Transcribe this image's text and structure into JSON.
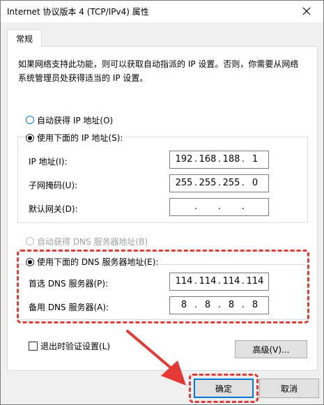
{
  "window": {
    "title": "Internet 协议版本 4 (TCP/IPv4) 属性"
  },
  "tabs": [
    {
      "label": "常规"
    }
  ],
  "description": "如果网络支持此功能，则可以获取自动指派的 IP 设置。否则，你需要从网络系统管理员处获得适当的 IP 设置。",
  "ip_section": {
    "auto_label": "自动获得 IP 地址(O)",
    "manual_label": "使用下面的 IP 地址(S):",
    "fields": [
      {
        "label": "IP 地址(I):",
        "octets": [
          "192",
          "168",
          "188",
          "1"
        ]
      },
      {
        "label": "子网掩码(U):",
        "octets": [
          "255",
          "255",
          "255",
          "0"
        ]
      },
      {
        "label": "默认网关(D):",
        "octets": [
          "",
          "",
          "",
          ""
        ]
      }
    ]
  },
  "dns_section": {
    "auto_label": "自动获得 DNS 服务器地址(B)",
    "manual_label": "使用下面的 DNS 服务器地址(E):",
    "fields": [
      {
        "label": "首选 DNS 服务器(P):",
        "octets": [
          "114",
          "114",
          "114",
          "114"
        ]
      },
      {
        "label": "备用 DNS 服务器(A):",
        "octets": [
          "8",
          "8",
          "8",
          "8"
        ]
      }
    ]
  },
  "validate_label": "退出时验证设置(L)",
  "advanced_button": "高级(V)...",
  "ok_button": "确定",
  "cancel_button": "取消",
  "annotation": {
    "color": "#e53935"
  },
  "colors": {
    "accent": "#0078d7",
    "panel": "#ffffff",
    "window": "#f0f0f0"
  }
}
